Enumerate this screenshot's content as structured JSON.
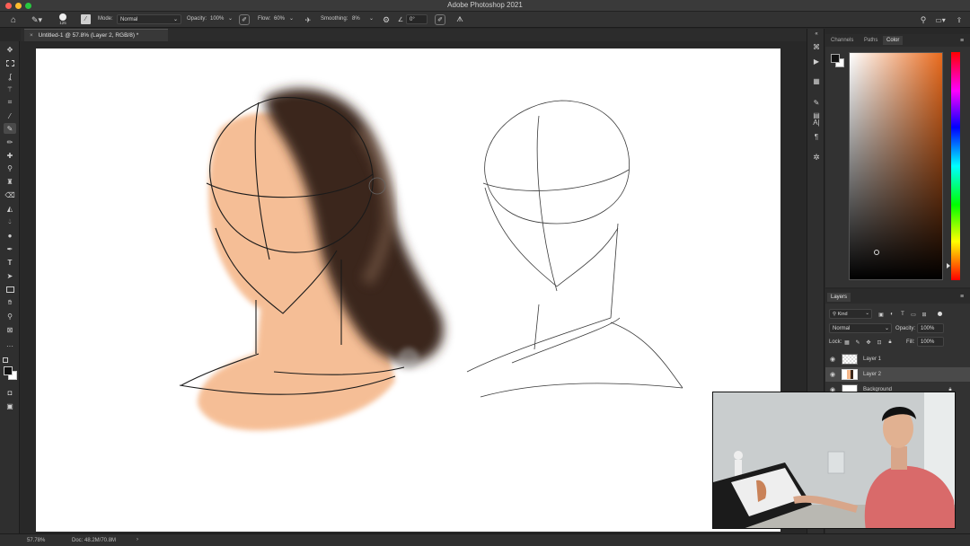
{
  "app_title": "Adobe Photoshop 2021",
  "colors": {
    "accent": "#e96b1e",
    "panel_bg": "#323232",
    "canvas_bg": "#ffffff",
    "skin": "#f5b88b",
    "hair": "#3b271b"
  },
  "options_bar": {
    "brush_size": "125",
    "mode_label": "Mode:",
    "mode_value": "Normal",
    "opacity_label": "Opacity:",
    "opacity_value": "100%",
    "flow_label": "Flow:",
    "flow_value": "60%",
    "smoothing_label": "Smoothing:",
    "smoothing_value": "8%",
    "angle_value": "0°"
  },
  "document_tab": {
    "label": "Untitled-1 @ 57.8% (Layer 2, RGB/8) *"
  },
  "status_bar": {
    "zoom": "57.78%",
    "doc_info": "Doc: 48.2M/70.8M"
  },
  "color_panel": {
    "tabs": [
      "Channels",
      "Paths",
      "Color"
    ],
    "active_tab": "Color"
  },
  "layers_panel": {
    "title": "Layers",
    "filter_kind": "Kind",
    "blend_mode": "Normal",
    "opacity_label": "Opacity:",
    "opacity_value": "100%",
    "lock_label": "Lock:",
    "fill_label": "Fill:",
    "fill_value": "100%",
    "layers": [
      {
        "name": "Layer 1",
        "selected": false
      },
      {
        "name": "Layer 2",
        "selected": true
      },
      {
        "name": "Background",
        "selected": false
      }
    ]
  },
  "tool_icons": [
    "move-icon",
    "marquee-icon",
    "lasso-icon",
    "magic-wand-icon",
    "crop-icon",
    "eyedropper-icon",
    "brush-icon",
    "pencil-icon",
    "healing-icon",
    "clone-stamp-icon",
    "history-brush-icon",
    "eraser-icon",
    "paint-bucket-icon",
    "blur-icon",
    "dodge-icon",
    "pen-icon",
    "type-icon",
    "path-select-icon",
    "rectangle-icon",
    "hand-icon",
    "zoom-icon",
    "frame-icon",
    "more-icon"
  ]
}
